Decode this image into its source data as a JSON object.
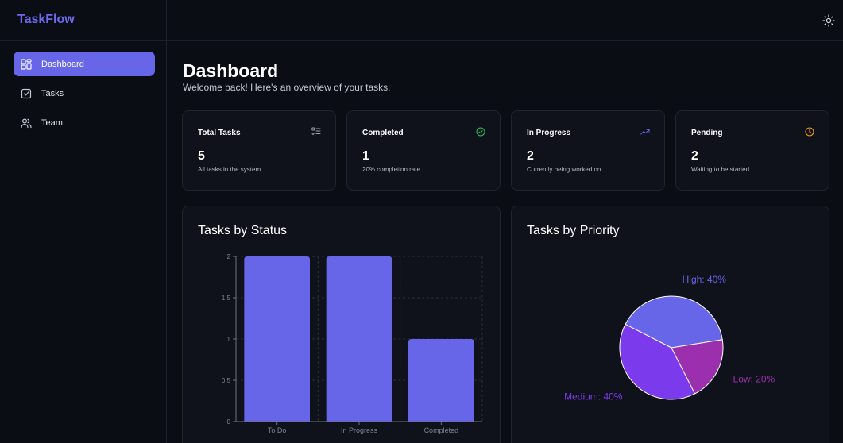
{
  "app": {
    "name": "TaskFlow"
  },
  "header": {
    "theme_icon": "sun-icon"
  },
  "sidebar": {
    "items": [
      {
        "label": "Dashboard",
        "icon": "dashboard-grid-icon",
        "active": true
      },
      {
        "label": "Tasks",
        "icon": "checkbox-icon",
        "active": false
      },
      {
        "label": "Team",
        "icon": "users-icon",
        "active": false
      }
    ]
  },
  "page": {
    "title": "Dashboard",
    "subtitle": "Welcome back! Here's an overview of your tasks."
  },
  "stats": [
    {
      "title": "Total Tasks",
      "value": "5",
      "desc": "All tasks in the system",
      "icon": "list-icon",
      "icon_color": "#9aa0ad"
    },
    {
      "title": "Completed",
      "value": "1",
      "desc": "20% completion rate",
      "icon": "check-circle-icon",
      "icon_color": "#22c55e"
    },
    {
      "title": "In Progress",
      "value": "2",
      "desc": "Currently being worked on",
      "icon": "trending-up-icon",
      "icon_color": "#6766e8"
    },
    {
      "title": "Pending",
      "value": "2",
      "desc": "Waiting to be started",
      "icon": "clock-icon",
      "icon_color": "#f59e0b"
    }
  ],
  "charts": {
    "status_title": "Tasks by Status",
    "priority_title": "Tasks by Priority"
  },
  "colors": {
    "accent": "#6766e8",
    "medium": "#7c3aed",
    "low": "#9b2fae"
  },
  "chart_data": [
    {
      "type": "bar",
      "title": "Tasks by Status",
      "categories": [
        "To Do",
        "In Progress",
        "Completed"
      ],
      "values": [
        2,
        2,
        1
      ],
      "ylim": [
        0,
        2
      ],
      "yticks": [
        "0",
        "0.5",
        "1",
        "1.5",
        "2"
      ],
      "grid": true,
      "color": "#6766e8"
    },
    {
      "type": "pie",
      "title": "Tasks by Priority",
      "slices": [
        {
          "label": "High: 40%",
          "value": 40,
          "color": "#6766e8"
        },
        {
          "label": "Low: 20%",
          "value": 20,
          "color": "#9b2fae"
        },
        {
          "label": "Medium: 40%",
          "value": 40,
          "color": "#7c3aed"
        }
      ]
    }
  ]
}
